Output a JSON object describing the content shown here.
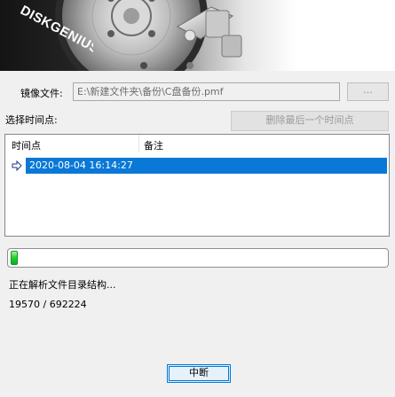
{
  "brand": {
    "logo_text": "DISKGENIUS",
    "logo_icon": "hard-disk-platter-icon"
  },
  "image_file": {
    "label": "镜像文件:",
    "value": "E:\\新建文件夹\\备份\\C盘备份.pmf",
    "browse_label": "..."
  },
  "timepoint": {
    "label": "选择时间点:",
    "delete_label": "删除最后一个时间点",
    "columns": [
      "时间点",
      "备注"
    ],
    "rows": [
      {
        "time": "2020-08-04 16:14:27",
        "note": "",
        "selected": true,
        "icon": "right-arrow-icon"
      }
    ]
  },
  "progress": {
    "fraction": 0.0154,
    "status": "正在解析文件目录结构...",
    "count": "19570 / 692224"
  },
  "abort_label": "中断",
  "colors": {
    "selection": "#0a78d7",
    "progress_green": "#06b025",
    "focus_border": "#0078d7"
  }
}
